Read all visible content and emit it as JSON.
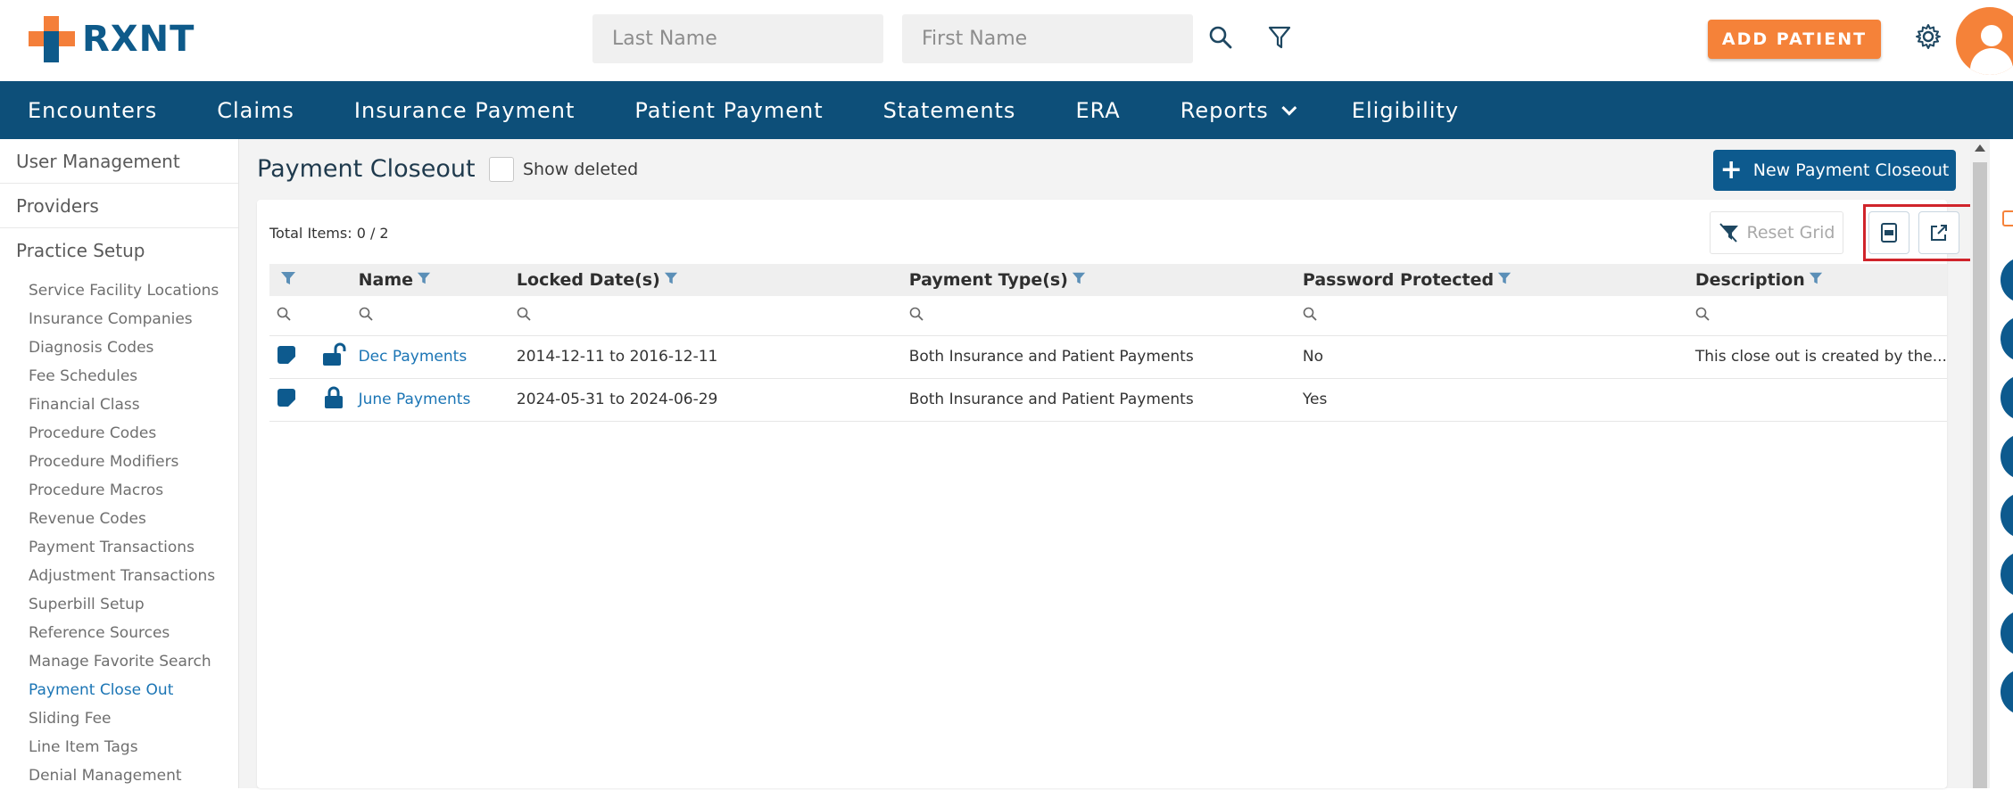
{
  "app": {
    "logo_text": "RXNT"
  },
  "header": {
    "last_name_placeholder": "Last Name",
    "first_name_placeholder": "First Name",
    "add_patient_label": "ADD PATIENT"
  },
  "nav": {
    "items": [
      {
        "label": "Encounters"
      },
      {
        "label": "Claims"
      },
      {
        "label": "Insurance Payment"
      },
      {
        "label": "Patient Payment"
      },
      {
        "label": "Statements"
      },
      {
        "label": "ERA"
      },
      {
        "label": "Reports"
      },
      {
        "label": "Eligibility"
      }
    ]
  },
  "sidebar": {
    "sections": [
      "User Management",
      "Providers",
      "Practice Setup"
    ],
    "items": [
      "Service Facility Locations",
      "Insurance Companies",
      "Diagnosis Codes",
      "Fee Schedules",
      "Financial Class",
      "Procedure Codes",
      "Procedure Modifiers",
      "Procedure Macros",
      "Revenue Codes",
      "Payment Transactions",
      "Adjustment Transactions",
      "Superbill Setup",
      "Reference Sources",
      "Manage Favorite Search",
      "Payment Close Out",
      "Sliding Fee",
      "Line Item Tags",
      "Denial Management"
    ],
    "active_item": "Payment Close Out"
  },
  "page": {
    "title": "Payment Closeout",
    "show_deleted_label": "Show deleted",
    "new_button_label": "New Payment Closeout"
  },
  "grid": {
    "total_items": "Total Items: 0 / 2",
    "reset_label": "Reset Grid",
    "columns": [
      "Name",
      "Locked Date(s)",
      "Payment Type(s)",
      "Password Protected",
      "Description"
    ],
    "rows": [
      {
        "name": "Dec Payments",
        "locked_dates": "2014-12-11 to 2016-12-11",
        "payment_types": "Both Insurance and Patient Payments",
        "password_protected": "No",
        "description": "This close out is created by the...",
        "locked": false
      },
      {
        "name": "June Payments",
        "locked_dates": "2024-05-31 to 2024-06-29",
        "payment_types": "Both Insurance and Patient Payments",
        "password_protected": "Yes",
        "description": "",
        "locked": true
      }
    ]
  },
  "colors": {
    "brand_blue": "#0d4f79",
    "brand_orange": "#f58239",
    "link": "#1b75b5",
    "highlight": "#d0242b"
  },
  "icons": [
    "search-icon",
    "filter-icon",
    "gear-icon",
    "user-avatar-icon",
    "plus-icon",
    "reset-filter-icon",
    "export-pdf-icon",
    "export-icon",
    "edit-icon",
    "unlocked-icon",
    "locked-icon"
  ]
}
